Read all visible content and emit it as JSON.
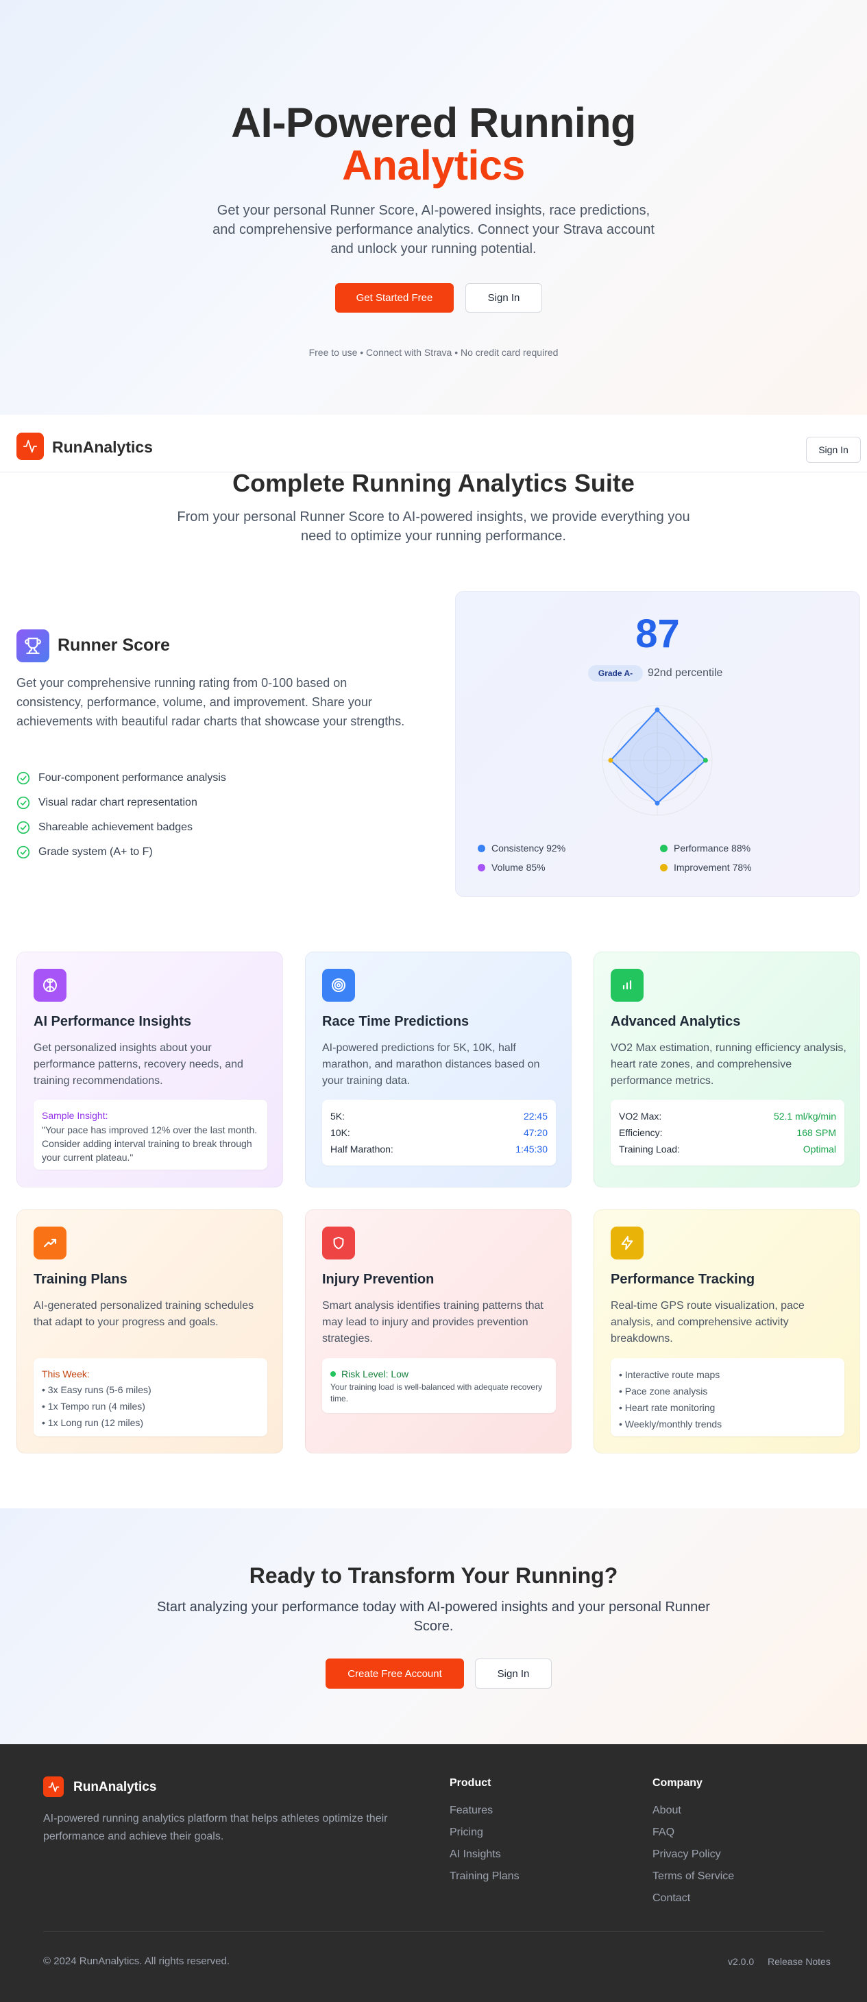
{
  "hero": {
    "title_line1": "AI-Powered Running",
    "title_line2": "Analytics",
    "lead": "Get your personal Runner Score, AI-powered insights, race predictions, and comprehensive performance analytics. Connect your Strava account and unlock your running potential.",
    "primary_button": "Get Started Free",
    "secondary_button": "Sign In",
    "note": "Free to use • Connect with Strava • No credit card required"
  },
  "nav": {
    "brand": "RunAnalytics",
    "logo_icon": "activity-pulse-icon",
    "signin": "Sign In"
  },
  "suite": {
    "title": "Complete Running Analytics Suite",
    "subtitle": "From your personal Runner Score to AI-powered insights, we provide everything you need to optimize your running performance."
  },
  "runner_score": {
    "icon": "trophy-icon",
    "title": "Runner Score",
    "description": "Get your comprehensive running rating from 0-100 based on consistency, performance, volume, and improvement. Share your achievements with beautiful radar charts that showcase your strengths.",
    "features": [
      "Four-component performance analysis",
      "Visual radar chart representation",
      "Shareable achievement badges",
      "Grade system (A+ to F)"
    ],
    "score": "87",
    "grade": "Grade A-",
    "percentile": "92nd percentile",
    "legend": [
      {
        "label": "Consistency 92%",
        "color": "#3b82f6"
      },
      {
        "label": "Performance 88%",
        "color": "#22c55e"
      },
      {
        "label": "Volume 85%",
        "color": "#a855f7"
      },
      {
        "label": "Improvement 78%",
        "color": "#eab308"
      }
    ]
  },
  "chart_data": {
    "type": "radar",
    "axes": [
      "Consistency",
      "Performance",
      "Improvement",
      "Volume"
    ],
    "values": [
      92,
      88,
      78,
      85
    ],
    "max": 100
  },
  "cards": {
    "ai": {
      "icon": "brain-icon",
      "title": "AI Performance Insights",
      "description": "Get personalized insights about your performance patterns, recovery needs, and training recommendations.",
      "sample_title": "Sample Insight:",
      "sample_text": "\"Your pace has improved 12% over the last month. Consider adding interval training to break through your current plateau.\""
    },
    "race": {
      "icon": "target-icon",
      "title": "Race Time Predictions",
      "description": "AI-powered predictions for 5K, 10K, half marathon, and marathon distances based on your training data.",
      "rows": [
        {
          "label": "5K:",
          "value": "22:45"
        },
        {
          "label": "10K:",
          "value": "47:20"
        },
        {
          "label": "Half Marathon:",
          "value": "1:45:30"
        }
      ]
    },
    "analytics": {
      "icon": "bar-chart-icon",
      "title": "Advanced Analytics",
      "description": "VO2 Max estimation, running efficiency analysis, heart rate zones, and comprehensive performance metrics.",
      "rows": [
        {
          "label": "VO2 Max:",
          "value": "52.1 ml/kg/min"
        },
        {
          "label": "Efficiency:",
          "value": "168 SPM"
        },
        {
          "label": "Training Load:",
          "value": "Optimal"
        }
      ]
    },
    "plans": {
      "icon": "trending-up-icon",
      "title": "Training Plans",
      "description": "AI-generated personalized training schedules that adapt to your progress and goals.",
      "week_title": "This Week:",
      "items": [
        "• 3x Easy runs (5-6 miles)",
        "• 1x Tempo run (4 miles)",
        "• 1x Long run (12 miles)"
      ]
    },
    "injury": {
      "icon": "shield-icon",
      "title": "Injury Prevention",
      "description": "Smart analysis identifies training patterns that may lead to injury and provides prevention strategies.",
      "risk_title": "Risk Level: Low",
      "risk_text": "Your training load is well-balanced with adequate recovery time."
    },
    "tracking": {
      "icon": "lightning-icon",
      "title": "Performance Tracking",
      "description": "Real-time GPS route visualization, pace analysis, and comprehensive activity breakdowns.",
      "items": [
        "• Interactive route maps",
        "• Pace zone analysis",
        "• Heart rate monitoring",
        "• Weekly/monthly trends"
      ]
    }
  },
  "cta": {
    "title": "Ready to Transform Your Running?",
    "subtitle": "Start analyzing your performance today with AI-powered insights and your personal Runner Score.",
    "primary_button": "Create Free Account",
    "secondary_button": "Sign In"
  },
  "footer": {
    "brand": "RunAnalytics",
    "description": "AI-powered running analytics platform that helps athletes optimize their performance and achieve their goals.",
    "product_title": "Product",
    "product_links": [
      "Features",
      "Pricing",
      "AI Insights",
      "Training Plans"
    ],
    "company_title": "Company",
    "company_links": [
      "About",
      "FAQ",
      "Privacy Policy",
      "Terms of Service",
      "Contact"
    ],
    "copyright": "© 2024 RunAnalytics. All rights reserved.",
    "version": "v2.0.0",
    "release_notes": "Release Notes"
  }
}
